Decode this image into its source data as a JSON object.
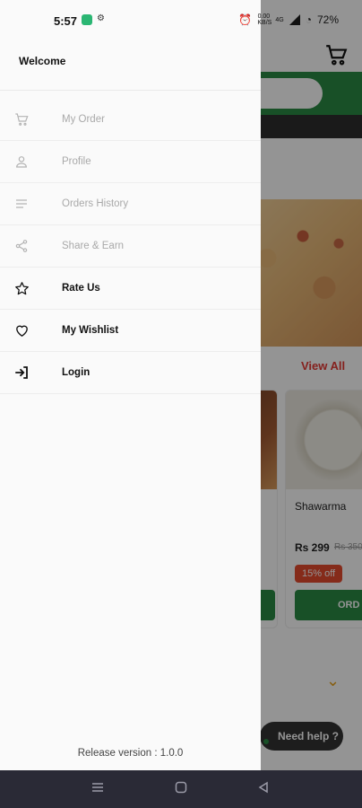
{
  "status_bar": {
    "time": "5:57",
    "battery_percent": "72%",
    "network_speed": "0.00 KB/S",
    "sim_label": "4G"
  },
  "drawer": {
    "welcome_text": "Welcome",
    "menu_items": [
      {
        "label": "My Order",
        "icon": "cart-icon",
        "state": "muted"
      },
      {
        "label": "Profile",
        "icon": "person-icon",
        "state": "muted"
      },
      {
        "label": "Orders History",
        "icon": "list-icon",
        "state": "muted"
      },
      {
        "label": "Share & Earn",
        "icon": "share-icon",
        "state": "muted"
      },
      {
        "label": "Rate Us",
        "icon": "star-icon",
        "state": "active"
      },
      {
        "label": "My Wishlist",
        "icon": "heart-icon",
        "state": "active"
      },
      {
        "label": "Login",
        "icon": "login-icon",
        "state": "active"
      }
    ],
    "release_version": "Release version : 1.0.0"
  },
  "background_app": {
    "view_all": "View All",
    "product": {
      "name": "Shawarma",
      "price": "Rs 299",
      "old_price": "Rs 350",
      "discount": "15% off",
      "order_button": "ORD"
    },
    "help_button": "Need help ?"
  },
  "colors": {
    "brand_green": "#2a8a44",
    "accent_red": "#e53935",
    "drawer_bg": "#fafafa",
    "nav_bar": "#2a2a36"
  }
}
